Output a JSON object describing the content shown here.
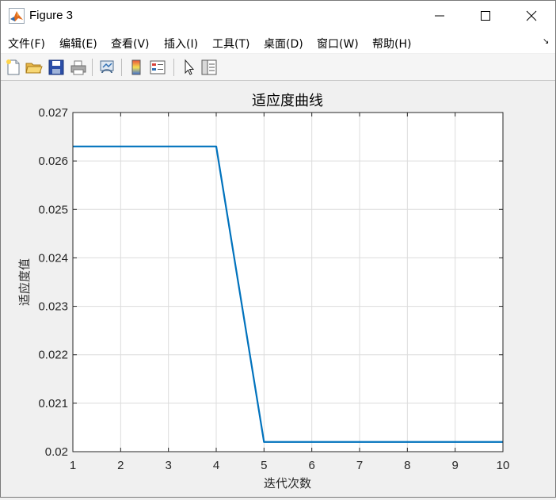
{
  "window": {
    "title": "Figure 3",
    "icon": "matlab-logo-icon",
    "controls": [
      "minimize-icon",
      "maximize-icon",
      "close-icon"
    ]
  },
  "menu": {
    "items": [
      "文件(F)",
      "编辑(E)",
      "查看(V)",
      "插入(I)",
      "工具(T)",
      "桌面(D)",
      "窗口(W)",
      "帮助(H)"
    ],
    "overflow_icon": "dock-arrow-icon"
  },
  "toolbar": {
    "buttons": [
      "new-figure-icon",
      "open-file-icon",
      "save-icon",
      "print-icon",
      "link-plot-icon",
      "colorbar-icon",
      "legend-icon",
      "pointer-icon",
      "property-inspector-icon"
    ]
  },
  "chart_data": {
    "type": "line",
    "title": "适应度曲线",
    "xlabel": "迭代次数",
    "ylabel": "适应度值",
    "x": [
      1,
      2,
      3,
      4,
      5,
      6,
      7,
      8,
      9,
      10
    ],
    "series": [
      {
        "values": [
          0.0263,
          0.0263,
          0.0263,
          0.0263,
          0.0202,
          0.0202,
          0.0202,
          0.0202,
          0.0202,
          0.0202
        ],
        "color": "#0072bd"
      }
    ],
    "xlim": [
      1,
      10
    ],
    "ylim": [
      0.02,
      0.027
    ],
    "xticks": [
      "1",
      "2",
      "3",
      "4",
      "5",
      "6",
      "7",
      "8",
      "9",
      "10"
    ],
    "yticks": [
      "0.02",
      "0.021",
      "0.022",
      "0.023",
      "0.024",
      "0.025",
      "0.026",
      "0.027"
    ],
    "grid": true
  }
}
